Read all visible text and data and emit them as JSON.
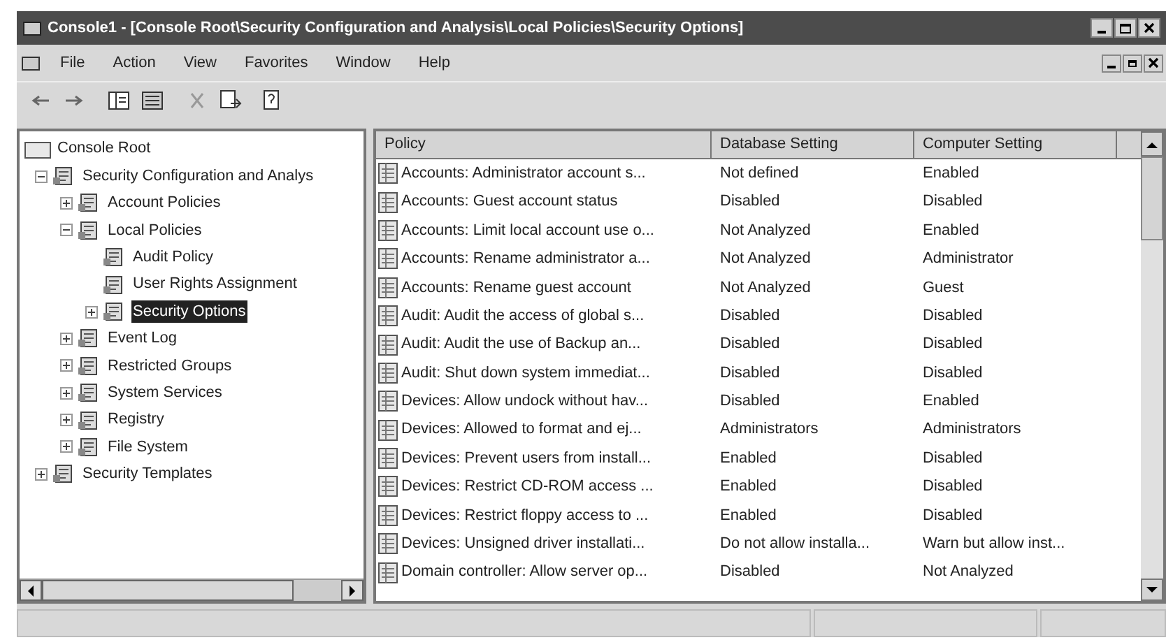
{
  "window": {
    "title": "Console1 - [Console Root\\Security Configuration and Analysis\\Local Policies\\Security Options]"
  },
  "menu": [
    "File",
    "Action",
    "View",
    "Favorites",
    "Window",
    "Help"
  ],
  "tree": [
    {
      "label": "Console Root",
      "selected": false,
      "children": [
        {
          "label": "Security Configuration and Analys",
          "selected": false,
          "expanded": true,
          "children": [
            {
              "label": "Account Policies",
              "selected": false,
              "expanded": false
            },
            {
              "label": "Local Policies",
              "selected": false,
              "expanded": true,
              "children": [
                {
                  "label": "Audit Policy",
                  "selected": false
                },
                {
                  "label": "User Rights Assignment",
                  "selected": false
                },
                {
                  "label": "Security Options",
                  "selected": true,
                  "expanded": false
                }
              ]
            },
            {
              "label": "Event Log",
              "selected": false,
              "expanded": false
            },
            {
              "label": "Restricted Groups",
              "selected": false,
              "expanded": false
            },
            {
              "label": "System Services",
              "selected": false,
              "expanded": false
            },
            {
              "label": "Registry",
              "selected": false,
              "expanded": false
            },
            {
              "label": "File System",
              "selected": false,
              "expanded": false
            }
          ]
        },
        {
          "label": "Security Templates",
          "selected": false,
          "expanded": false
        }
      ]
    }
  ],
  "table": {
    "columns": [
      "Policy",
      "Database Setting",
      "Computer Setting"
    ],
    "rows": [
      [
        "Accounts: Administrator account s...",
        "Not defined",
        "Enabled"
      ],
      [
        "Accounts: Guest account status",
        "Disabled",
        "Disabled"
      ],
      [
        "Accounts: Limit local account use o...",
        "Not Analyzed",
        "Enabled"
      ],
      [
        "Accounts: Rename administrator a...",
        "Not Analyzed",
        "Administrator"
      ],
      [
        "Accounts: Rename guest account",
        "Not Analyzed",
        "Guest"
      ],
      [
        "Audit: Audit the access of global s...",
        "Disabled",
        "Disabled"
      ],
      [
        "Audit: Audit the use of Backup an...",
        "Disabled",
        "Disabled"
      ],
      [
        "Audit: Shut down system immediat...",
        "Disabled",
        "Disabled"
      ],
      [
        "Devices: Allow undock without hav...",
        "Disabled",
        "Enabled"
      ],
      [
        "Devices: Allowed to format and ej...",
        "Administrators",
        "Administrators"
      ],
      [
        "Devices: Prevent users from install...",
        "Enabled",
        "Disabled"
      ],
      [
        "Devices: Restrict CD-ROM access ...",
        "Enabled",
        "Disabled"
      ],
      [
        "Devices: Restrict floppy access to ...",
        "Enabled",
        "Disabled"
      ],
      [
        "Devices: Unsigned driver installati...",
        "Do not allow installa...",
        "Warn but allow inst..."
      ],
      [
        "Domain controller: Allow server op...",
        "Disabled",
        "Not Analyzed"
      ]
    ]
  }
}
